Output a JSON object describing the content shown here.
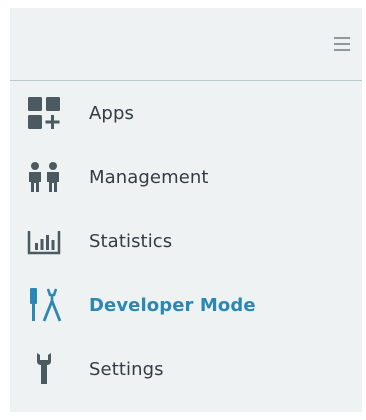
{
  "colors": {
    "panel_bg": "#eef2f2",
    "text": "#333c40",
    "icon": "#4a5a60",
    "active": "#2b88b4"
  },
  "header": {
    "menu_icon": "hamburger-icon"
  },
  "nav": {
    "items": [
      {
        "label": "Apps",
        "icon": "apps-grid-icon",
        "active": false
      },
      {
        "label": "Management",
        "icon": "users-icon",
        "active": false
      },
      {
        "label": "Statistics",
        "icon": "bar-chart-icon",
        "active": false
      },
      {
        "label": "Developer Mode",
        "icon": "tools-icon",
        "active": true
      },
      {
        "label": "Settings",
        "icon": "wrench-icon",
        "active": false
      }
    ]
  }
}
